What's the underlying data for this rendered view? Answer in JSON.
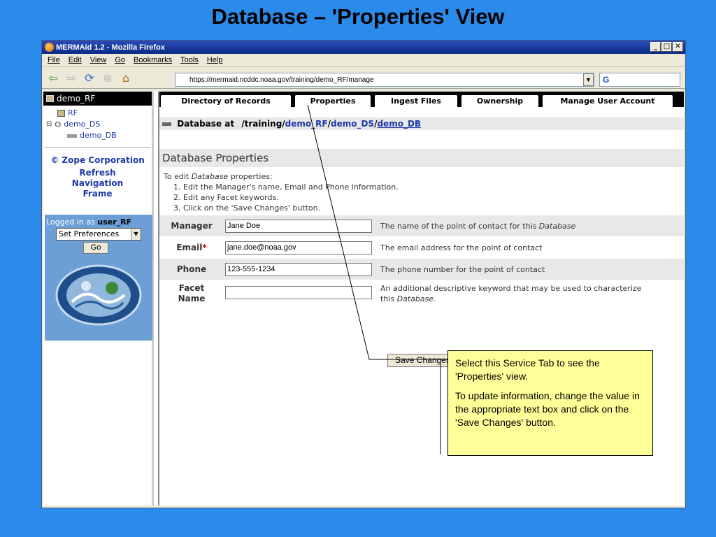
{
  "slide": {
    "title": "Database – 'Properties' View"
  },
  "window": {
    "title": "MERMAid 1.2 - Mozilla Firefox",
    "buttons": {
      "minimize": "_",
      "maximize": "□",
      "close": "✕"
    }
  },
  "menu": [
    "File",
    "Edit",
    "View",
    "Go",
    "Bookmarks",
    "Tools",
    "Help"
  ],
  "navbar": {
    "url": "https://mermaid.ncddc.noaa.gov/training/demo_RF/manage",
    "search_value": "G"
  },
  "left_pane": {
    "header": "demo_RF",
    "tree": [
      "RF",
      "demo_DS",
      "demo_DB"
    ],
    "tree_toggle": "⊟",
    "zope_link": "© Zope Corporation",
    "refresh_lines": [
      "Refresh",
      "Navigation",
      "Frame"
    ],
    "logged_in_prefix": "Logged in as ",
    "user": "user_RF",
    "prefs_select": "Set Preferences",
    "go_button": "Go"
  },
  "tabs": [
    "Directory of Records",
    "Properties",
    "Ingest Files",
    "Ownership",
    "Manage User Account"
  ],
  "breadcrumb": {
    "prefix": "Database at",
    "path_start": "/training/",
    "seg1": "demo_RF",
    "slash1": "/",
    "seg2": "demo_DS",
    "slash2": "/",
    "seg3": "demo_DB"
  },
  "section_title": "Database Properties",
  "instructions": {
    "intro_prefix": "To edit ",
    "intro_em": "Database",
    "intro_suffix": " properties:",
    "steps": [
      "1. Edit the Manager's name, Email and Phone information.",
      "2. Edit any Facet keywords.",
      "3. Click on the 'Save Changes' button."
    ]
  },
  "fields": {
    "manager": {
      "label": "Manager",
      "value": "Jane Doe",
      "help_prefix": "The name of the point of contact for this ",
      "help_em": "Database"
    },
    "email": {
      "label": "Email",
      "required_mark": "*",
      "value": "jane.doe@noaa.gov",
      "help": "The email address for the point of contact"
    },
    "phone": {
      "label": "Phone",
      "value": "123-555-1234",
      "help": "The phone number for the point of contact"
    },
    "facet": {
      "label_line1": "Facet",
      "label_line2": "Name",
      "value": "",
      "help_line1": "An additional descriptive keyword that may be used to characterize",
      "help_line2_prefix": "this ",
      "help_line2_em": "Database",
      "help_line2_suffix": "."
    }
  },
  "save_button": "Save Changes",
  "callout": {
    "p1": "Select this Service Tab to see the 'Properties' view.",
    "p2": "To update information, change the value in the appropriate text box and click on the 'Save Changes' button."
  },
  "colors": {
    "slide_bg": "#2b8bea",
    "callout_bg": "#ffff99",
    "login_bg": "#6b9fd6",
    "link": "#1f3aa8"
  }
}
